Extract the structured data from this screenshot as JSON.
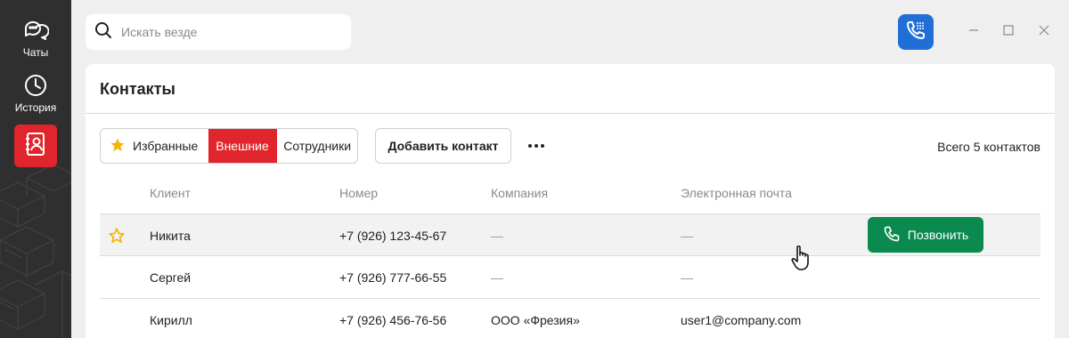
{
  "sidebar": {
    "items": [
      {
        "label": "Чаты",
        "icon": "chat-bubbles-icon"
      },
      {
        "label": "История",
        "icon": "clock-icon"
      },
      {
        "label": "",
        "icon": "contacts-book-icon",
        "active": true
      }
    ],
    "accent": "#e0262c",
    "background": "#2f2f2f"
  },
  "search": {
    "placeholder": "Искать везде",
    "value": ""
  },
  "topbar": {
    "phone_app_icon": "phone-keypad-icon",
    "phone_app_color": "#1f6fd6"
  },
  "panel": {
    "title": "Контакты",
    "filters": [
      {
        "label": "Избранные",
        "icon": "star-icon",
        "active": false
      },
      {
        "label": "Внешние",
        "active": true
      },
      {
        "label": "Сотрудники",
        "active": false
      }
    ],
    "add_label": "Добавить контакт",
    "more_icon": "more-horizontal-icon",
    "total_label": "Всего 5 контактов"
  },
  "table": {
    "columns": [
      "Клиент",
      "Номер",
      "Компания",
      "Электронная почта"
    ],
    "rows": [
      {
        "favorite": true,
        "client": "Никита",
        "number": "+7 (926) 123-45-67",
        "company": "—",
        "email": "—",
        "call_label": "Позвонить"
      },
      {
        "favorite": false,
        "client": "Сергей",
        "number": "+7 (926) 777-66-55",
        "company": "—",
        "email": "—"
      },
      {
        "favorite": false,
        "client": "Кирилл",
        "number": "+7 (926) 456-76-56",
        "company": "ООО «Фрезия»",
        "email": "user1@company.com"
      }
    ]
  },
  "colors": {
    "call_button": "#0a8a4f",
    "star": "#f5b400"
  }
}
